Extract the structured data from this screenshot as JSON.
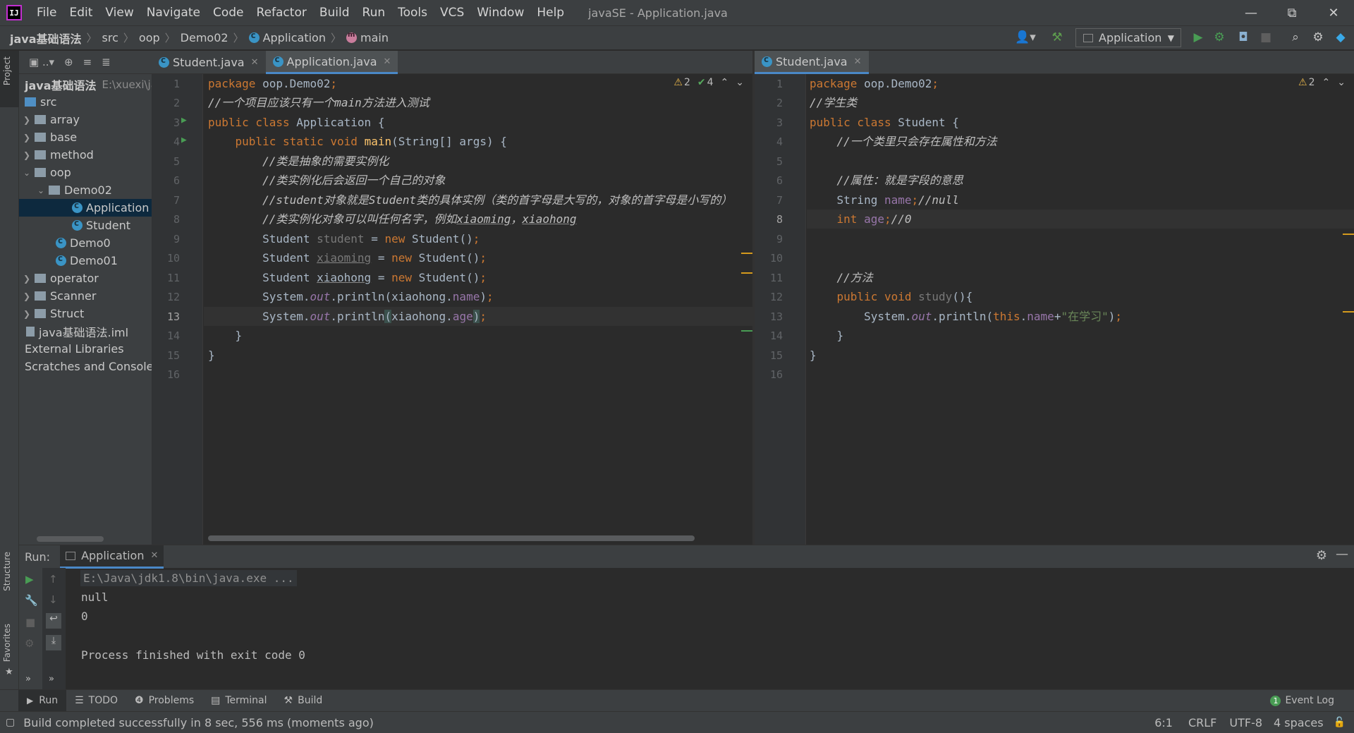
{
  "menubar": {
    "logo": "IJ",
    "items": [
      "File",
      "Edit",
      "View",
      "Navigate",
      "Code",
      "Refactor",
      "Build",
      "Run",
      "Tools",
      "VCS",
      "Window",
      "Help"
    ],
    "title": "javaSE - Application.java"
  },
  "navbar": {
    "crumbs": [
      "java基础语法",
      "src",
      "oop",
      "Demo02",
      "Application",
      "main"
    ],
    "run_config": "Application"
  },
  "sidebar": {
    "project_label": "Project",
    "structure_label": "Structure",
    "favorites_label": "Favorites"
  },
  "project": {
    "root_name": "java基础语法",
    "root_path": "E:\\xuexi\\jav",
    "items": [
      {
        "label": "src",
        "depth": 0
      },
      {
        "label": "array",
        "depth": 1
      },
      {
        "label": "base",
        "depth": 1
      },
      {
        "label": "method",
        "depth": 1
      },
      {
        "label": "oop",
        "depth": 1
      },
      {
        "label": "Demo02",
        "depth": 2
      },
      {
        "label": "Application",
        "depth": 3
      },
      {
        "label": "Student",
        "depth": 3
      },
      {
        "label": "Demo0",
        "depth": 2
      },
      {
        "label": "Demo01",
        "depth": 2
      },
      {
        "label": "operator",
        "depth": 1
      },
      {
        "label": "Scanner",
        "depth": 1
      },
      {
        "label": "Struct",
        "depth": 1
      },
      {
        "label": "java基础语法.iml",
        "depth": 0
      },
      {
        "label": "External Libraries",
        "depth": 0
      },
      {
        "label": "Scratches and Consoles",
        "depth": 0
      }
    ]
  },
  "tabs_left": [
    {
      "label": "Student.java"
    },
    {
      "label": "Application.java"
    }
  ],
  "tabs_right": [
    {
      "label": "Student.java"
    }
  ],
  "editor_left": {
    "warnings": "2",
    "checks": "4",
    "line_numbers": [
      "1",
      "2",
      "3",
      "4",
      "5",
      "6",
      "7",
      "8",
      "9",
      "10",
      "11",
      "12",
      "13",
      "14",
      "15",
      "16"
    ]
  },
  "editor_right": {
    "warnings": "2",
    "line_numbers": [
      "1",
      "2",
      "3",
      "4",
      "5",
      "6",
      "7",
      "8",
      "9",
      "10",
      "11",
      "12",
      "13",
      "14",
      "15",
      "16"
    ]
  },
  "run": {
    "label": "Run:",
    "tab": "Application",
    "output": [
      "E:\\Java\\jdk1.8\\bin\\java.exe ...",
      "null",
      "0",
      "",
      "Process finished with exit code 0"
    ]
  },
  "bottom_tabs": {
    "run": "Run",
    "todo": "TODO",
    "problems": "Problems",
    "terminal": "Terminal",
    "build": "Build",
    "event_count": "1",
    "event_log": "Event Log"
  },
  "status": {
    "message": "Build completed successfully in 8 sec, 556 ms (moments ago)",
    "position": "6:1",
    "line_sep": "CRLF",
    "encoding": "UTF-8",
    "indent": "4 spaces"
  },
  "colors": {
    "accent": "#4a88c7",
    "selection": "#0d293e",
    "keyword": "#cc7832",
    "string": "#6a8759",
    "field": "#9876aa"
  }
}
